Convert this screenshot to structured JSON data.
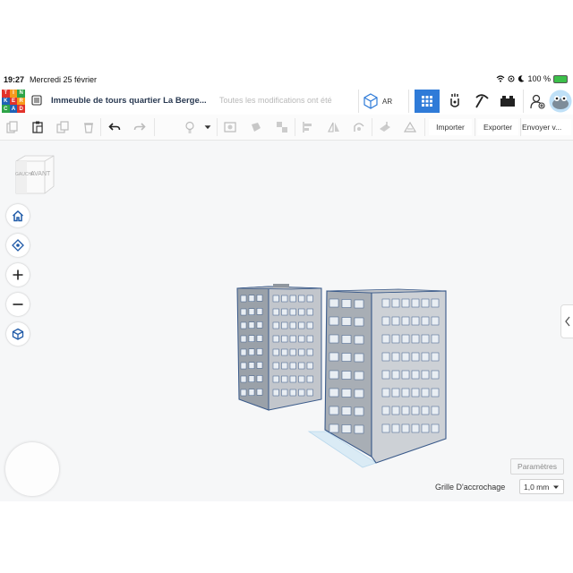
{
  "status_bar": {
    "time": "19:27",
    "date": "Mercredi 25 février",
    "battery": "100 %"
  },
  "app_bar": {
    "logo_letters": [
      "T",
      "I",
      "N",
      "K",
      "E",
      "R",
      "C",
      "A",
      "D"
    ],
    "logo_colors": [
      "#e2322a",
      "#f79a1b",
      "#2ea447",
      "#1f62b6",
      "#e2322a",
      "#f79a1b",
      "#2ea447",
      "#1f62b6",
      "#e2322a"
    ],
    "document_title": "Immeuble de tours quartier La Berge...",
    "save_status": "Toutes les modifications ont été",
    "ar_label": "AR",
    "icons": [
      "ar-cube-icon",
      "grid-view-icon",
      "blocks-icon",
      "bricks-pickaxe-icon",
      "lego-brick-icon",
      "add-user-icon",
      "avatar"
    ],
    "active_color": "#2f7bd8"
  },
  "toolbar": {
    "icons": [
      "copy-icon",
      "paste-icon",
      "duplicate-icon",
      "delete-icon",
      "undo-icon",
      "redo-icon",
      "light-bulb-icon",
      "shape-view-icon",
      "solid-hole-icon",
      "group-icon",
      "ungroup-icon",
      "align-icon",
      "mirror-icon",
      "cruise-icon",
      "workplane-icon",
      "ruler-icon"
    ],
    "import_label": "Importer",
    "export_label": "Exporter",
    "send_label": "Envoyer v..."
  },
  "canvas": {
    "viewcube_left": "GAUCHE",
    "viewcube_front": "AVANT",
    "nav_icons": [
      "home-icon",
      "fit-view-icon",
      "zoom-in-icon",
      "zoom-out-icon",
      "perspective-icon"
    ],
    "params_label": "Paramètres",
    "grid_label": "Grille D'accrochage",
    "grid_value": "1,0 mm"
  }
}
